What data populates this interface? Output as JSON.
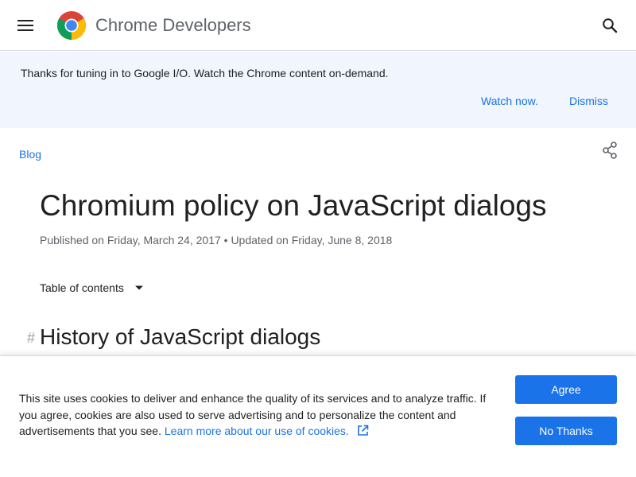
{
  "header": {
    "brand": "Chrome Developers",
    "icons": {
      "menu": "hamburger-menu-icon",
      "logo": "chrome-logo",
      "search": "search-icon"
    }
  },
  "banner": {
    "text": "Thanks for tuning in to Google I/O. Watch the Chrome content on-demand.",
    "watch_label": "Watch now.",
    "dismiss_label": "Dismiss"
  },
  "article": {
    "breadcrumb": "Blog",
    "title": "Chromium policy on JavaScript dialogs",
    "meta": "Published on Friday, March 24, 2017 • Updated on Friday, June 8, 2018",
    "toc_label": "Table of contents",
    "section_anchor": "#",
    "section_heading": "History of JavaScript dialogs",
    "icons": {
      "share": "share-icon",
      "toc": "chevron-down-icon"
    }
  },
  "cookie": {
    "text": "This site uses cookies to deliver and enhance the quality of its services and to analyze traffic. If you agree, cookies are also used to serve advertising and to personalize the content and advertisements that you see.",
    "link_label": "Learn more about our use of cookies.",
    "agree_label": "Agree",
    "no_thanks_label": "No Thanks",
    "icons": {
      "external": "external-link-icon"
    }
  },
  "colors": {
    "accent": "#1a73e8",
    "banner_bg": "#f1f5fd",
    "text": "#202124",
    "muted": "#5f6368"
  }
}
